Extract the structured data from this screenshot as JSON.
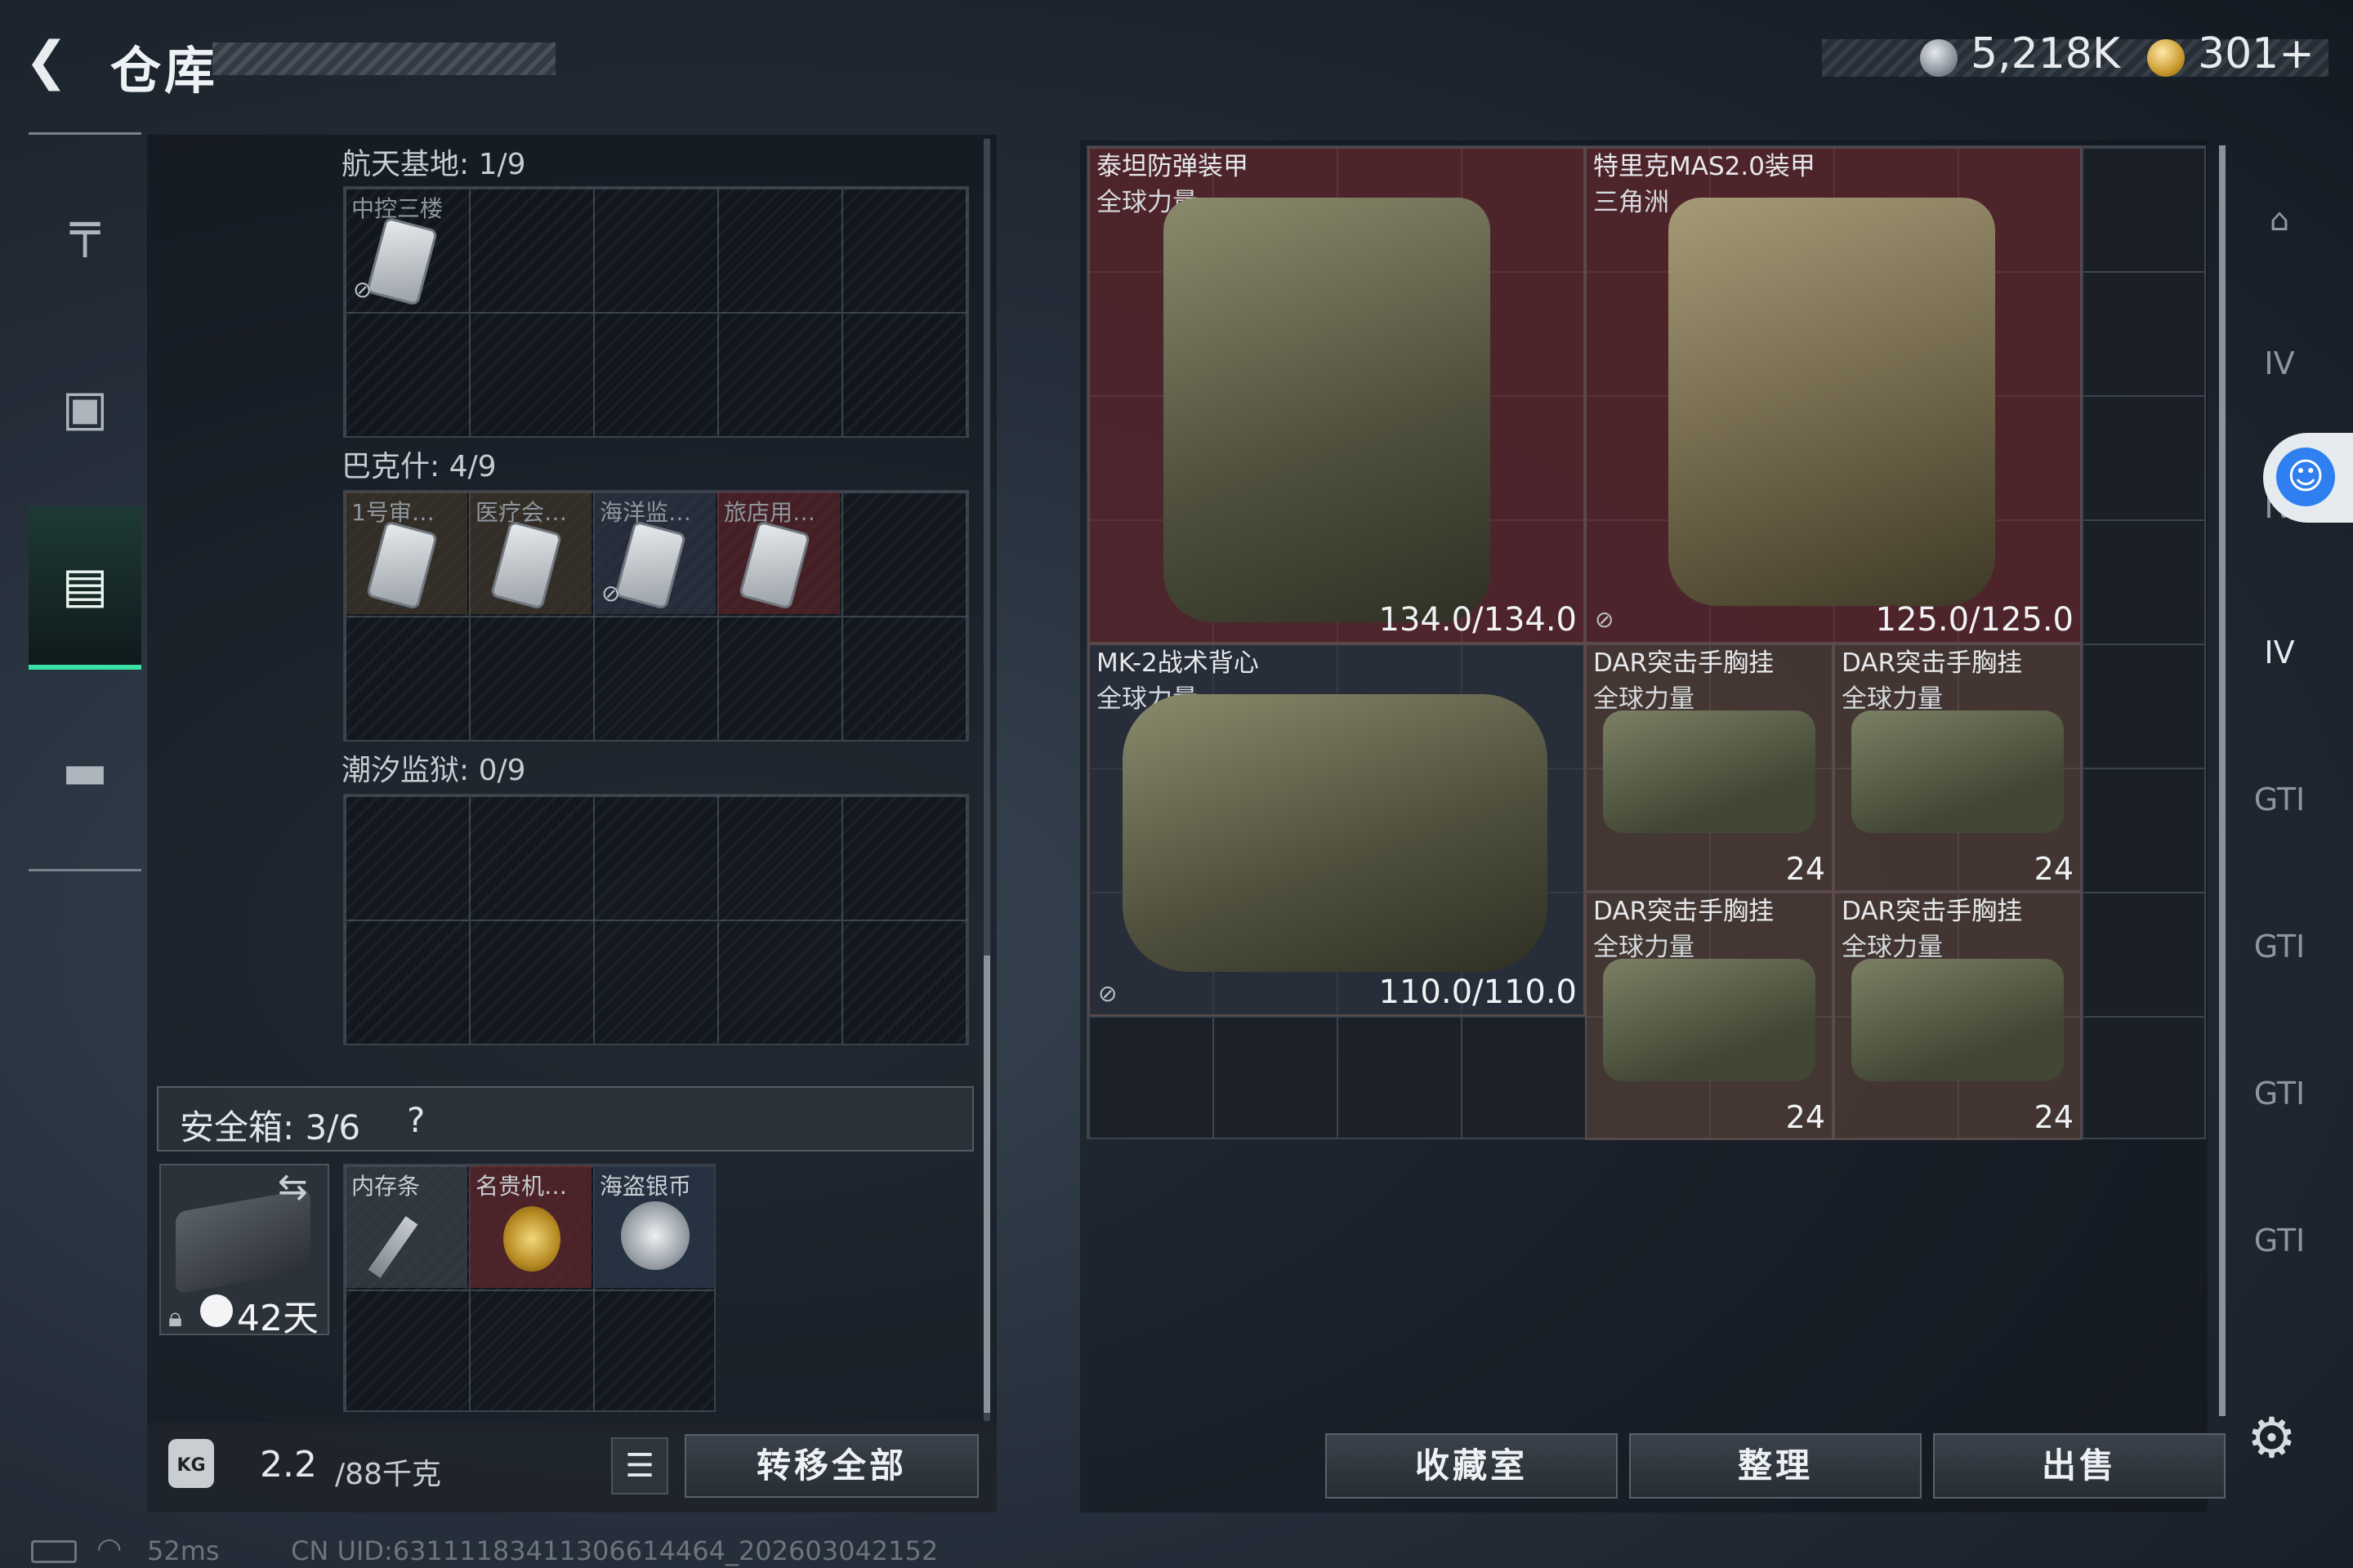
{
  "header": {
    "back_icon": "back-arrow-icon",
    "title": "仓库",
    "currency_silver_icon": "silver-coin-icon",
    "currency_silver": "5,218K",
    "currency_gold_icon": "gold-coin-icon",
    "currency_gold": "301+"
  },
  "left_nav": {
    "items": [
      {
        "icon": "pistol-icon",
        "glyph": "╤"
      },
      {
        "icon": "backpack-icon",
        "glyph": "▣"
      },
      {
        "icon": "stash-icon",
        "glyph": "▤",
        "selected": true
      },
      {
        "icon": "briefcase-icon",
        "glyph": "▬"
      }
    ]
  },
  "stash_sections": [
    {
      "label": "航天基地: 1/9",
      "slots": [
        {
          "name": "中控三楼",
          "no_sell": true
        }
      ]
    },
    {
      "label": "巴克什: 4/9",
      "slots": [
        {
          "name": "1号审…",
          "no_sell": false
        },
        {
          "name": "医疗会…",
          "no_sell": false
        },
        {
          "name": "海洋监…",
          "no_sell": true
        },
        {
          "name": "旅店用…",
          "no_sell": false
        }
      ]
    },
    {
      "label": "潮汐监狱: 0/9",
      "slots": []
    }
  ],
  "safe_box": {
    "label": "安全箱: 3/6",
    "help": "?",
    "days": "42天",
    "items": [
      {
        "name": "内存条"
      },
      {
        "name": "名贵机…"
      },
      {
        "name": "海盗银币"
      }
    ]
  },
  "footer_left": {
    "weight": "2.2",
    "weight_max": "/88千克",
    "kg_label": "KG",
    "list_icon": "☰",
    "transfer_all": "转移全部"
  },
  "inventory": {
    "items": [
      {
        "name": "泰坦防弹装甲",
        "sub": "全球力量",
        "durability": "134.0/134.0"
      },
      {
        "name": "特里克MAS2.0装甲",
        "sub": "三角洲",
        "durability": "125.0/125.0"
      },
      {
        "name": "MK-2战术背心",
        "sub": "全球力量",
        "durability": "110.0/110.0"
      },
      {
        "name": "DAR突击手胸挂",
        "sub": "全球力量",
        "capacity": "24"
      },
      {
        "name": "DAR突击手胸挂",
        "sub": "全球力量",
        "capacity": "24"
      },
      {
        "name": "DAR突击手胸挂",
        "sub": "全球力量",
        "capacity": "24"
      },
      {
        "name": "DAR突击手胸挂",
        "sub": "全球力量",
        "capacity": "24"
      }
    ]
  },
  "right_sidebar": {
    "items": [
      "helmet-icon",
      "armor-IV-icon",
      "armor-IV-alt-icon",
      "armor-IV-selected-icon",
      "rig-GTI-icon",
      "rig-GTI-alt-icon",
      "rig-GTI-2-icon",
      "rig-GTI-3-icon"
    ],
    "labels": [
      "⌂",
      "IV",
      "IV",
      "IV",
      "GTI",
      "GTI",
      "GTI",
      "GTI"
    ]
  },
  "actions": {
    "collection": "收藏室",
    "sort": "整理",
    "sell": "出售"
  },
  "status": {
    "ping": "52ms",
    "uid": "CN UID:6311118341130661446­4_202603042152"
  }
}
